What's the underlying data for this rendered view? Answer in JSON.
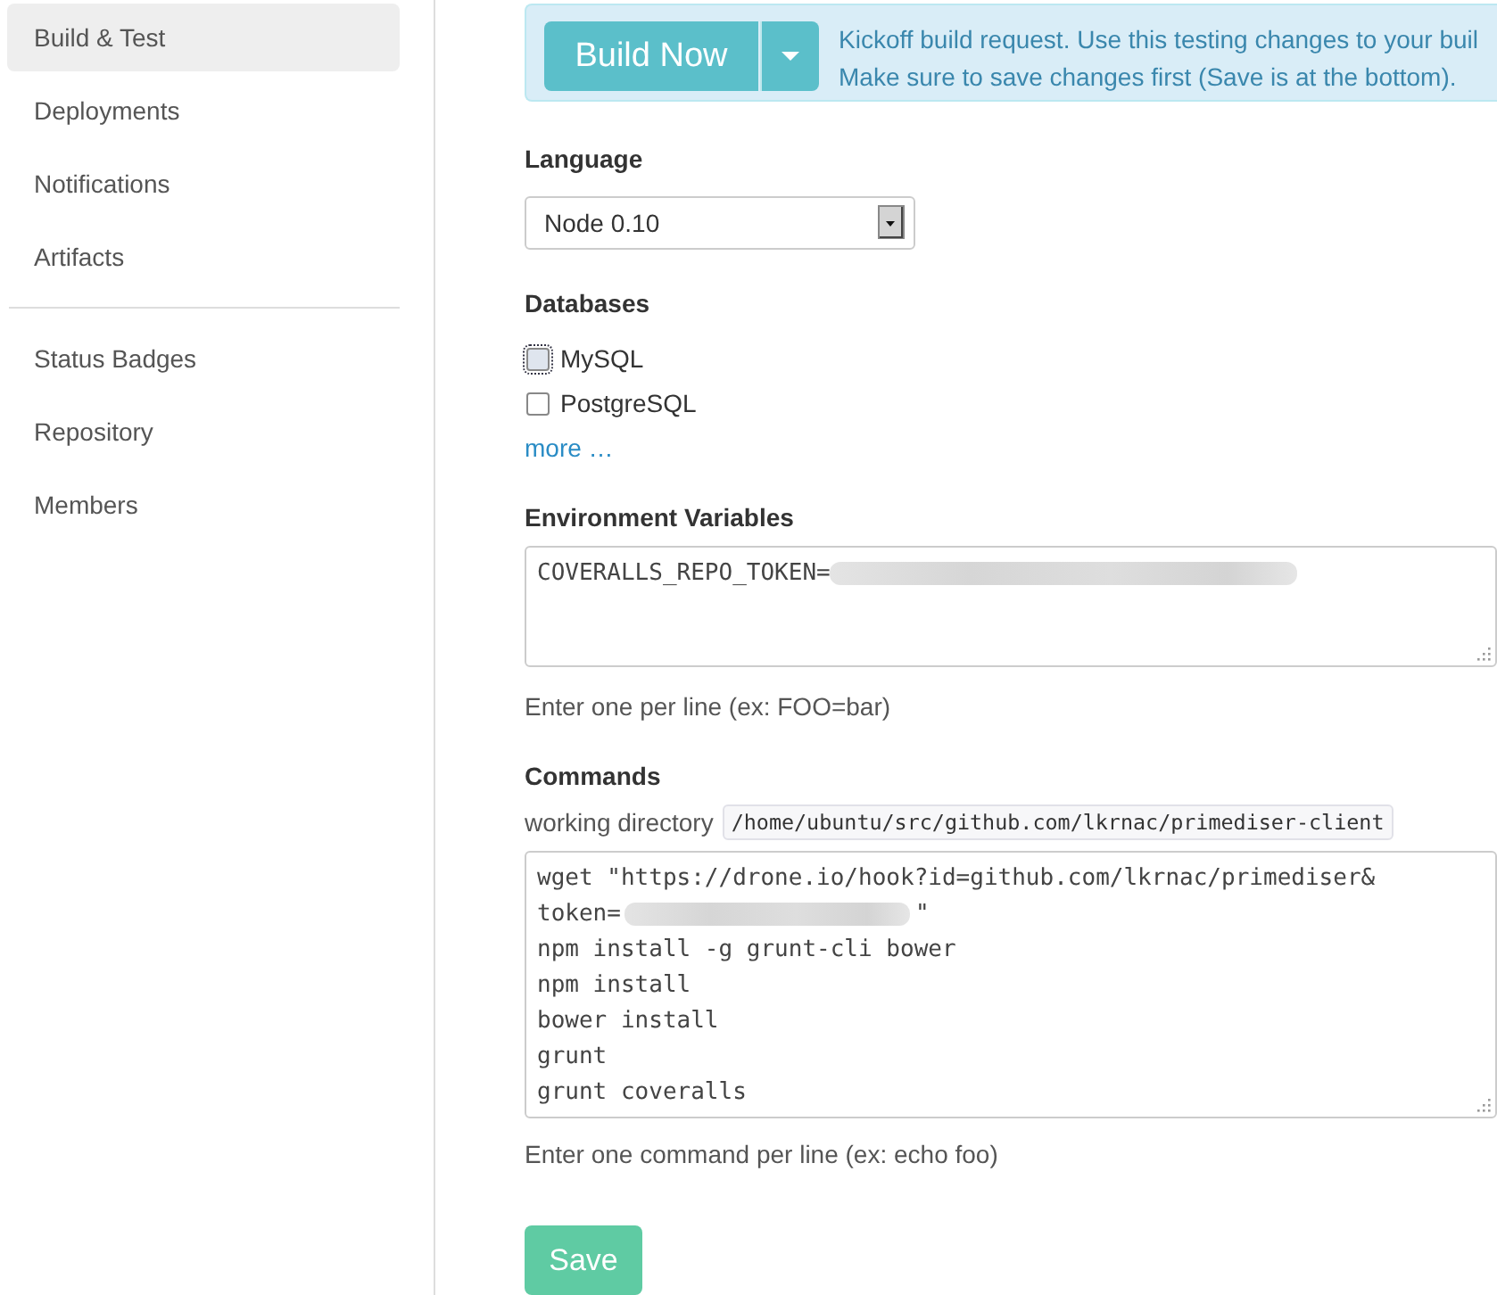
{
  "sidebar": {
    "groups": [
      {
        "items": [
          {
            "label": "Build & Test",
            "selected": true
          },
          {
            "label": "Deployments",
            "selected": false
          },
          {
            "label": "Notifications",
            "selected": false
          },
          {
            "label": "Artifacts",
            "selected": false
          }
        ]
      },
      {
        "items": [
          {
            "label": "Status Badges",
            "selected": false
          },
          {
            "label": "Repository",
            "selected": false
          },
          {
            "label": "Members",
            "selected": false
          }
        ]
      }
    ]
  },
  "build_alert": {
    "button": "Build Now",
    "message_lines": [
      "Kickoff build request. Use this testing changes to your buil",
      "Make sure to save changes first (Save is at the bottom)."
    ]
  },
  "language": {
    "label": "Language",
    "value": "Node 0.10"
  },
  "databases": {
    "label": "Databases",
    "options": [
      {
        "label": "MySQL",
        "checked": false,
        "focused": true
      },
      {
        "label": "PostgreSQL",
        "checked": false,
        "focused": false
      }
    ],
    "more_link": "more …"
  },
  "environment": {
    "label": "Environment Variables",
    "lines": [
      [
        {
          "kind": "text",
          "text": "COVERALLS_REPO_TOKEN="
        },
        {
          "kind": "blurred"
        }
      ]
    ],
    "help": "Enter one per line (ex: FOO=bar)"
  },
  "commands": {
    "label": "Commands",
    "working_directory_label": "working directory",
    "working_directory": "/home/ubuntu/src/github.com/lkrnac/primediser-client",
    "lines": [
      [
        {
          "kind": "text",
          "text": "wget \"https://drone.io/hook?id=github.com/lkrnac/primediser&"
        }
      ],
      [
        {
          "kind": "text",
          "text": "token="
        },
        {
          "kind": "blurred"
        },
        {
          "kind": "text",
          "text": "\""
        }
      ],
      [
        {
          "kind": "text",
          "text": "npm install -g grunt-cli bower"
        }
      ],
      [
        {
          "kind": "text",
          "text": "npm install"
        }
      ],
      [
        {
          "kind": "text",
          "text": "bower install"
        }
      ],
      [
        {
          "kind": "text",
          "text": "grunt"
        }
      ],
      [
        {
          "kind": "text",
          "text": "grunt coveralls"
        }
      ]
    ],
    "help": "Enter one command per line (ex: echo foo)"
  },
  "save_button": "Save"
}
